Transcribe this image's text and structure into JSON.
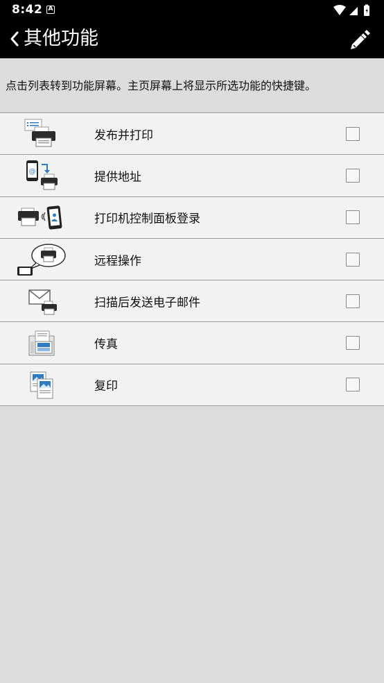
{
  "status_bar": {
    "time": "8:42",
    "notification_badge": "A",
    "icons": [
      "wifi-icon",
      "cellular-signal-icon",
      "battery-icon"
    ]
  },
  "app_bar": {
    "title": "其他功能",
    "back_icon": "chevron-left-icon",
    "edit_icon": "pencil-icon"
  },
  "description": "点击列表转到功能屏幕。主页屏幕上将显示所选功能的快捷键。",
  "features": [
    {
      "label": "发布并打印",
      "icon": "publish-print-icon",
      "checked": false
    },
    {
      "label": "提供地址",
      "icon": "provide-address-icon",
      "checked": false
    },
    {
      "label": "打印机控制面板登录",
      "icon": "printer-panel-login-icon",
      "checked": false
    },
    {
      "label": "远程操作",
      "icon": "remote-operation-icon",
      "checked": false
    },
    {
      "label": "扫描后发送电子邮件",
      "icon": "scan-to-email-icon",
      "checked": false
    },
    {
      "label": "传真",
      "icon": "fax-icon",
      "checked": false
    },
    {
      "label": "复印",
      "icon": "copy-icon",
      "checked": false
    }
  ],
  "colors": {
    "bar_background": "#000000",
    "list_background": "#f2f2f2",
    "page_background": "#dcdcdc",
    "divider": "#9c9c9c",
    "accent_blue": "#2f7bbf"
  }
}
